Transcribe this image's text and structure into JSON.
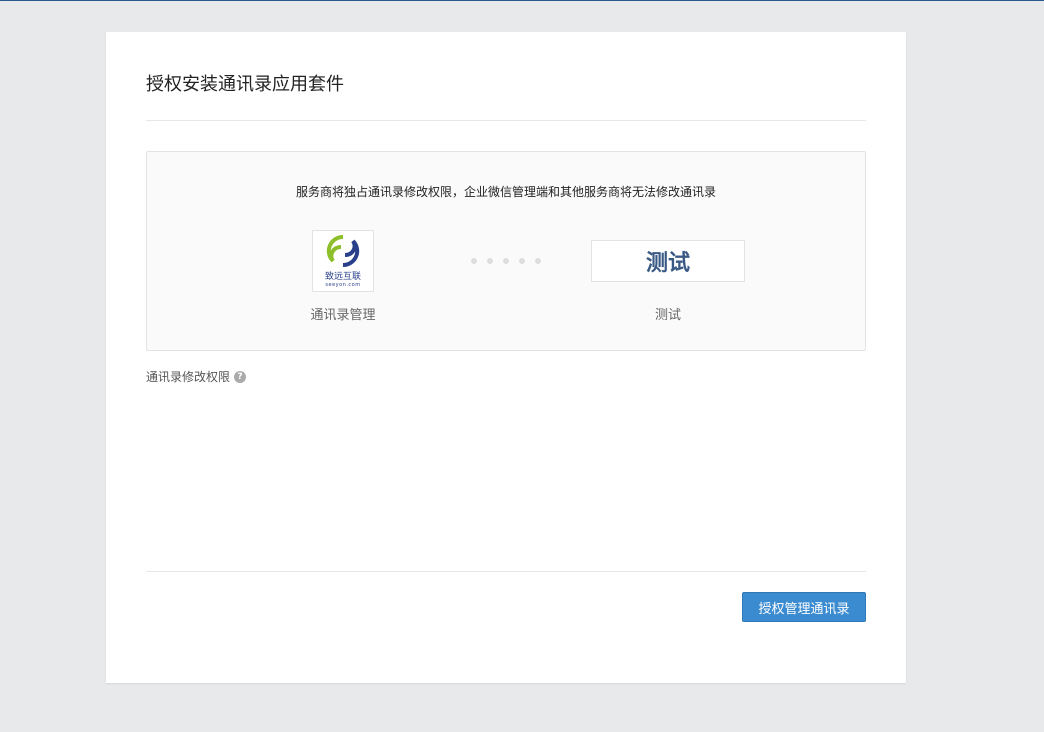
{
  "title": "授权安装通讯录应用套件",
  "notice": "服务商将独占通讯录修改权限，企业微信管理端和其他服务商将无法修改通讯录",
  "source_app": {
    "label": "通讯录管理",
    "logo_text": "致远互联",
    "logo_url_text": "seeyon.com"
  },
  "target_app": {
    "label": "测试",
    "logo_text": "测试"
  },
  "permission_label": "通讯录修改权限",
  "help_icon": "?",
  "authorize_button": "授权管理通讯录",
  "colors": {
    "primary": "#3b8bd0",
    "logo_text": "#3a5a85"
  }
}
